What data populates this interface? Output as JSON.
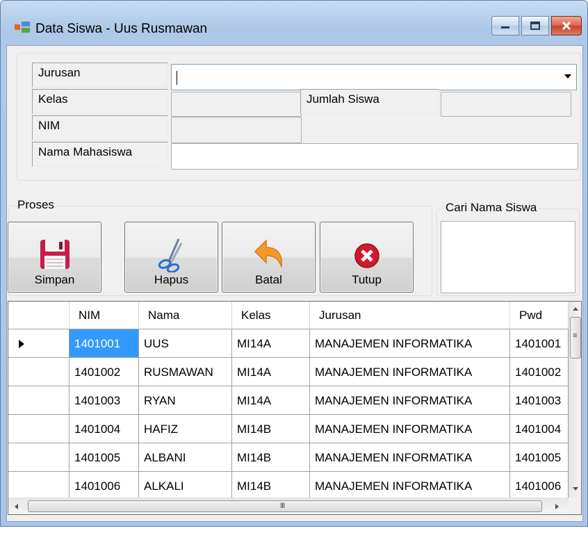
{
  "window": {
    "title": "Data Siswa - Uus Rusmawan",
    "controls": [
      "minimize-icon",
      "maximize-icon",
      "close-icon"
    ],
    "colors": {
      "titlebar": "#b9d1ee",
      "close": "#c74a2e",
      "client": "#f0f0f0",
      "selection": "#3399ff"
    }
  },
  "form": {
    "jurusan_label": "Jurusan",
    "jurusan_value": "",
    "kelas_label": "Kelas",
    "kelas_value": "",
    "jumlah_label": "Jumlah Siswa",
    "jumlah_value": "",
    "nim_label": "NIM",
    "nim_value": "",
    "nama_label": "Nama Mahasiswa",
    "nama_value": ""
  },
  "proses": {
    "caption": "Proses",
    "buttons": [
      {
        "label": "Simpan",
        "icon": "save-icon"
      },
      {
        "label": "Hapus",
        "icon": "scissors-icon"
      },
      {
        "label": "Batal",
        "icon": "undo-arrow-icon"
      },
      {
        "label": "Tutup",
        "icon": "close-circle-icon"
      }
    ]
  },
  "cari": {
    "caption": "Cari Nama Siswa",
    "value": ""
  },
  "grid": {
    "columns": [
      "NIM",
      "Nama",
      "Kelas",
      "Jurusan",
      "Pwd"
    ],
    "rows": [
      [
        "1401001",
        "UUS",
        "MI14A",
        "MANAJEMEN INFORMATIKA",
        "1401001"
      ],
      [
        "1401002",
        "RUSMAWAN",
        "MI14A",
        "MANAJEMEN INFORMATIKA",
        "1401002"
      ],
      [
        "1401003",
        "RYAN",
        "MI14A",
        "MANAJEMEN INFORMATIKA",
        "1401003"
      ],
      [
        "1401004",
        "HAFIZ",
        "MI14B",
        "MANAJEMEN INFORMATIKA",
        "1401004"
      ],
      [
        "1401005",
        "ALBANI",
        "MI14B",
        "MANAJEMEN INFORMATIKA",
        "1401005"
      ],
      [
        "1401006",
        "ALKALI",
        "MI14B",
        "MANAJEMEN INFORMATIKA",
        "1401006"
      ]
    ],
    "selected_row": 0,
    "hscroll_grip": "III"
  }
}
